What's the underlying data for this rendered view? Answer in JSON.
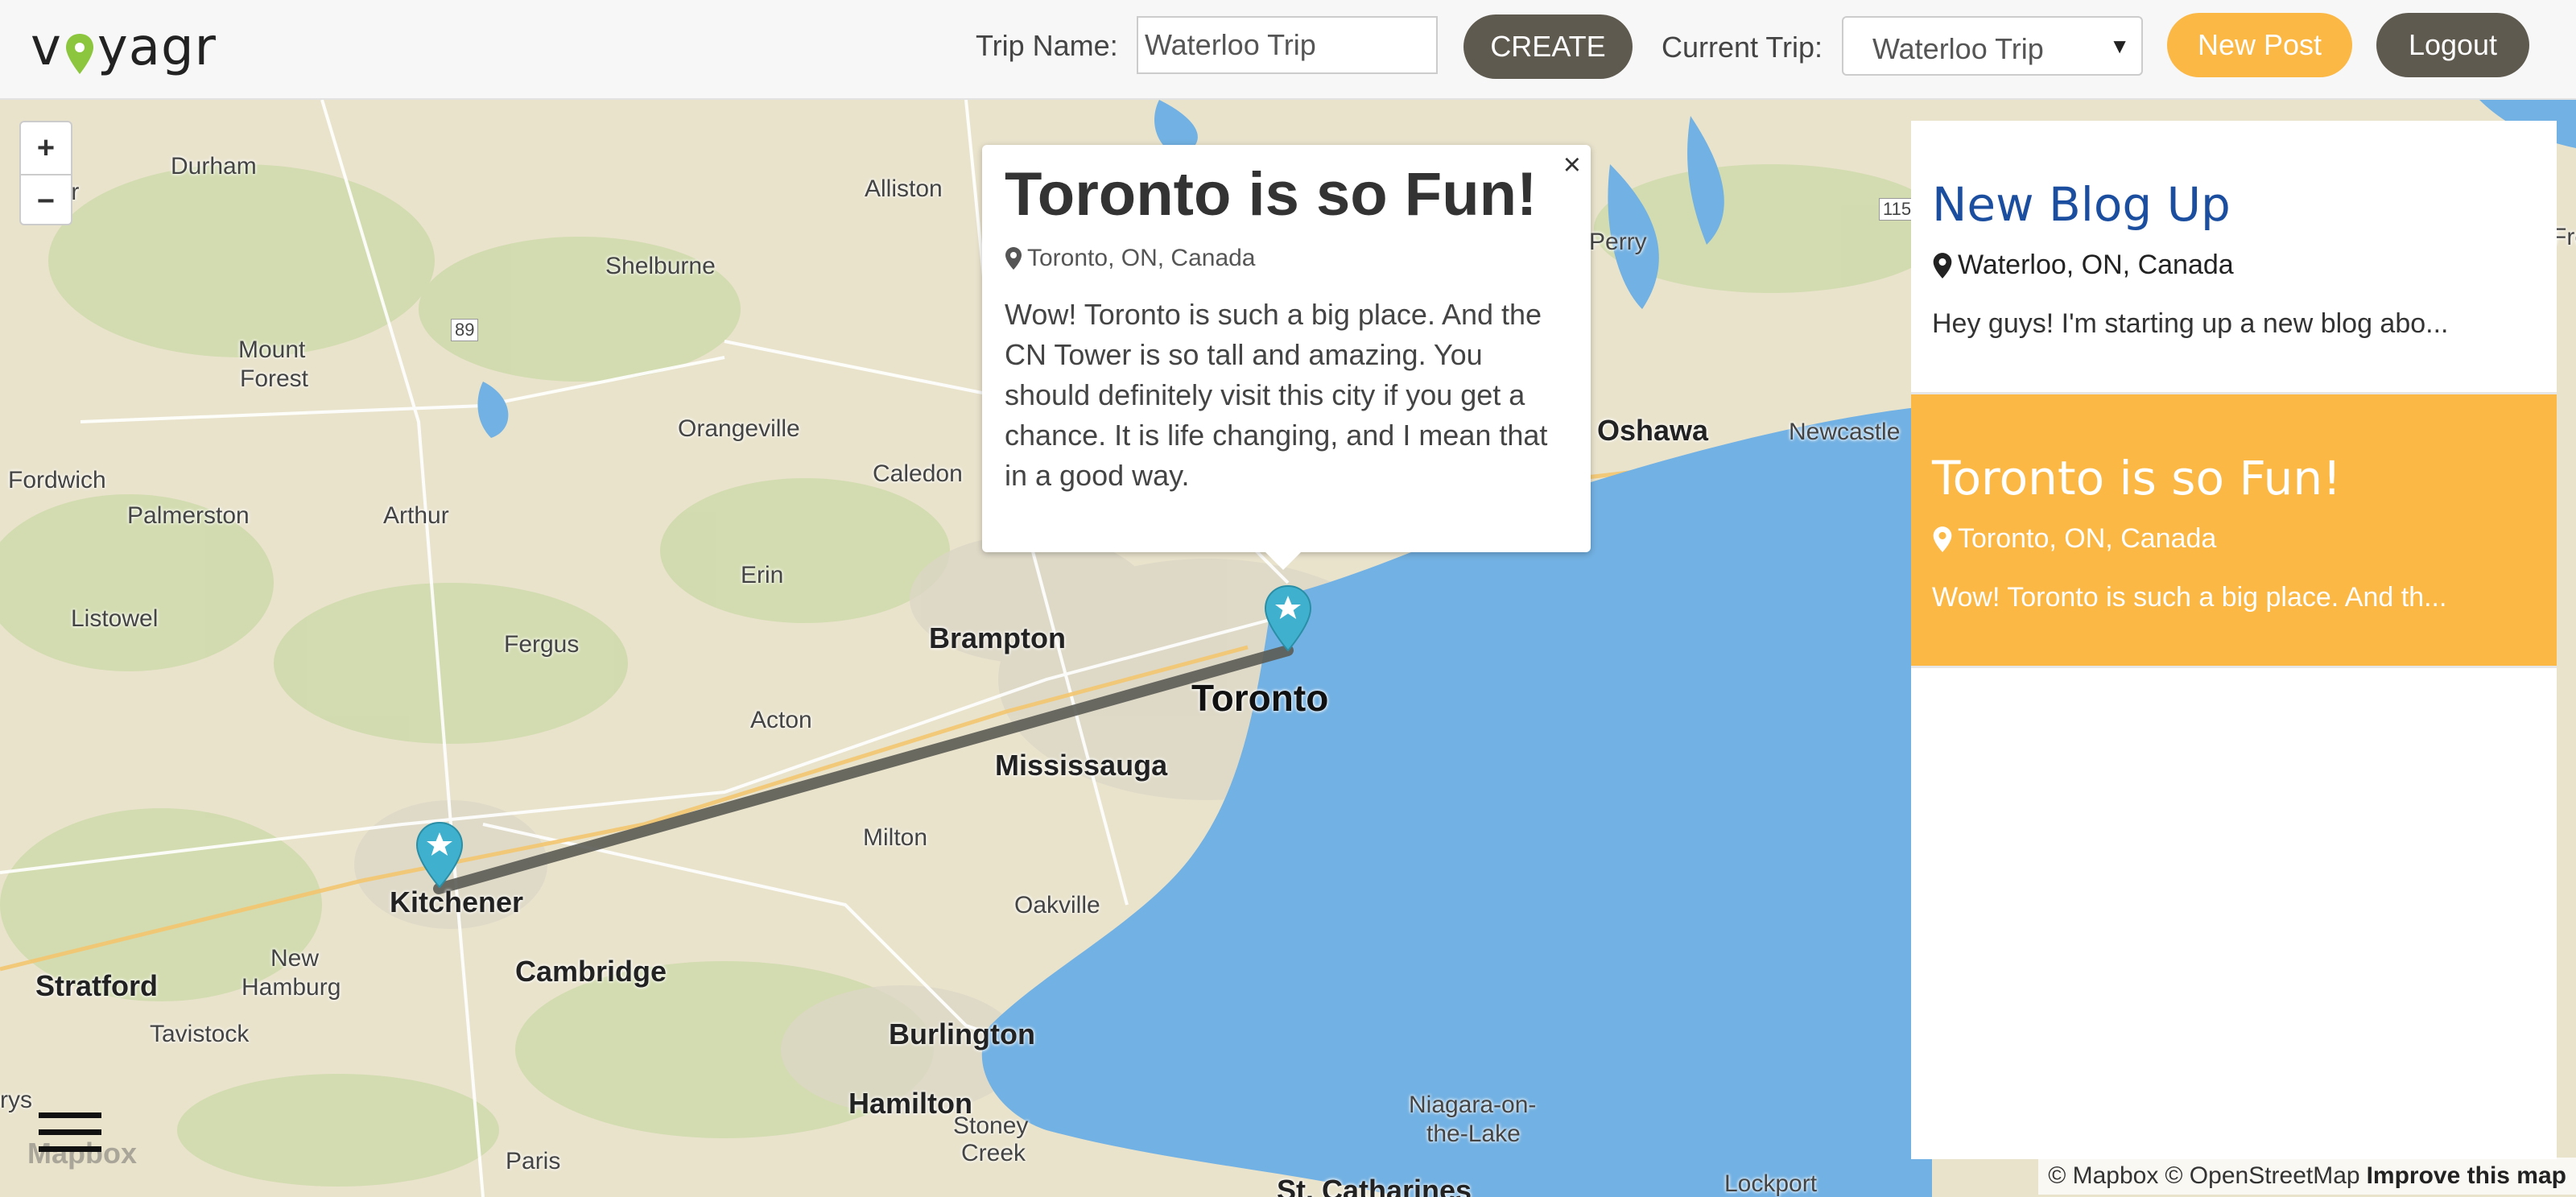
{
  "app": {
    "logo_before": "v",
    "logo_after": "yagr"
  },
  "header": {
    "trip_name_label": "Trip Name:",
    "trip_name_value": "Waterloo Trip",
    "create_label": "CREATE",
    "current_trip_label": "Current Trip:",
    "current_trip_value": "Waterloo Trip",
    "new_post_label": "New Post",
    "logout_label": "Logout"
  },
  "map": {
    "zoom_in": "+",
    "zoom_out": "−",
    "places": {
      "durham": "Durham",
      "hanover": "over",
      "alliston": "Alliston",
      "shelburne": "Shelburne",
      "mount": "Mount",
      "forest": "Forest",
      "hwy89": "89",
      "hwy115": "115",
      "perry": "Perry",
      "orangeville": "Orangeville",
      "caledon": "Caledon",
      "oshawa": "Oshawa",
      "newcastle": "Newcastle",
      "fordwich": "Fordwich",
      "palmerston": "Palmerston",
      "arthur": "Arthur",
      "erin": "Erin",
      "listowel": "Listowel",
      "fergus": "Fergus",
      "brampton": "Brampton",
      "toronto": "Toronto",
      "acton": "Acton",
      "mississauga": "Mississauga",
      "milton": "Milton",
      "kitchener": "Kitchener",
      "oakville": "Oakville",
      "new": "New",
      "hamburg": "Hamburg",
      "cambridge": "Cambridge",
      "stratford": "Stratford",
      "tavistock": "Tavistock",
      "burlington": "Burlington",
      "hamilton": "Hamilton",
      "stoney": "Stoney",
      "creek": "Creek",
      "niagara": "Niagara-on-",
      "the_lake": "the-Lake",
      "paris": "Paris",
      "stcatharines": "St. Catharines",
      "lockport": "Lockport",
      "rys": "rys",
      "fre": "Fre"
    },
    "mapbox_watermark": "Mapbox",
    "attribution": {
      "mapbox": "© Mapbox",
      "osm": "© OpenStreetMap",
      "improve": "Improve this map"
    }
  },
  "popup": {
    "close": "×",
    "title": "Toronto is so Fun!",
    "location": "Toronto, ON, Canada",
    "body": "Wow! Toronto is such a big place. And the CN Tower is so tall and amazing. You should definitely visit this city if you get a chance. It is life changing, and I mean that in a good way."
  },
  "posts": [
    {
      "title": "New Blog Up",
      "location": "Waterloo, ON, Canada",
      "excerpt": "Hey guys! I'm starting up a new blog abo..."
    },
    {
      "title": "Toronto is so Fun!",
      "location": "Toronto, ON, Canada",
      "excerpt": "Wow! Toronto is such a big place. And th..."
    }
  ],
  "colors": {
    "accent": "#fbb845",
    "dark_button": "#5f5a50",
    "water": "#72b1e3",
    "marker": "#3fb1ce",
    "title_blue": "#1c4ea0"
  }
}
